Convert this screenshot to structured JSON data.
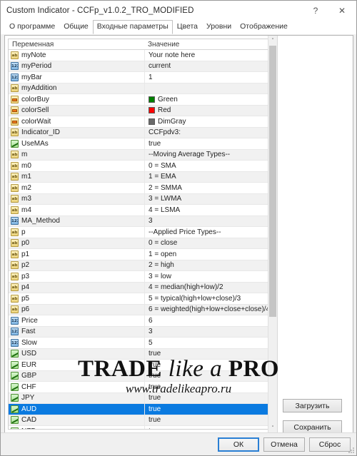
{
  "window": {
    "title": "Custom Indicator - CCFp_v1.0.2_TRO_MODIFIED",
    "help_label": "?",
    "close_label": "✕"
  },
  "tabs": [
    {
      "label": "О программе",
      "active": false
    },
    {
      "label": "Общие",
      "active": false
    },
    {
      "label": "Входные параметры",
      "active": true
    },
    {
      "label": "Цвета",
      "active": false
    },
    {
      "label": "Уровни",
      "active": false
    },
    {
      "label": "Отображение",
      "active": false
    }
  ],
  "grid": {
    "columns": [
      "Переменная",
      "Значение"
    ],
    "rows": [
      {
        "icon": "string-icon",
        "name": "myNote",
        "value": "Your note here"
      },
      {
        "icon": "int-icon",
        "name": "myPeriod",
        "value": "current"
      },
      {
        "icon": "int-icon",
        "name": "myBar",
        "value": "1"
      },
      {
        "icon": "string-icon",
        "name": "myAddition",
        "value": ""
      },
      {
        "icon": "color-icon",
        "name": "colorBuy",
        "value": "Green",
        "swatch": "#008000"
      },
      {
        "icon": "color-icon",
        "name": "colorSell",
        "value": "Red",
        "swatch": "#ff0000"
      },
      {
        "icon": "color-icon",
        "name": "colorWait",
        "value": "DimGray",
        "swatch": "#696969"
      },
      {
        "icon": "string-icon",
        "name": "Indicator_ID",
        "value": "CCFpdv3:"
      },
      {
        "icon": "bool-icon",
        "name": "UseMAs",
        "value": "true"
      },
      {
        "icon": "string-icon",
        "name": "m",
        "value": "--Moving Average Types--"
      },
      {
        "icon": "string-icon",
        "name": "m0",
        "value": "0 = SMA"
      },
      {
        "icon": "string-icon",
        "name": "m1",
        "value": "1 = EMA"
      },
      {
        "icon": "string-icon",
        "name": "m2",
        "value": "2 = SMMA"
      },
      {
        "icon": "string-icon",
        "name": "m3",
        "value": "3 = LWMA"
      },
      {
        "icon": "string-icon",
        "name": "m4",
        "value": "4 = LSMA"
      },
      {
        "icon": "int-icon",
        "name": "MA_Method",
        "value": "3"
      },
      {
        "icon": "string-icon",
        "name": "p",
        "value": "--Applied Price Types--"
      },
      {
        "icon": "string-icon",
        "name": "p0",
        "value": "0 = close"
      },
      {
        "icon": "string-icon",
        "name": "p1",
        "value": "1 = open"
      },
      {
        "icon": "string-icon",
        "name": "p2",
        "value": "2 = high"
      },
      {
        "icon": "string-icon",
        "name": "p3",
        "value": "3 = low"
      },
      {
        "icon": "string-icon",
        "name": "p4",
        "value": "4 = median(high+low)/2"
      },
      {
        "icon": "string-icon",
        "name": "p5",
        "value": "5 = typical(high+low+close)/3"
      },
      {
        "icon": "string-icon",
        "name": "p6",
        "value": "6 = weighted(high+low+close+close)/4"
      },
      {
        "icon": "int-icon",
        "name": "Price",
        "value": "6"
      },
      {
        "icon": "int-icon",
        "name": "Fast",
        "value": "3"
      },
      {
        "icon": "int-icon",
        "name": "Slow",
        "value": "5"
      },
      {
        "icon": "bool-icon",
        "name": "USD",
        "value": "true"
      },
      {
        "icon": "bool-icon",
        "name": "EUR",
        "value": "true"
      },
      {
        "icon": "bool-icon",
        "name": "GBP",
        "value": "true"
      },
      {
        "icon": "bool-icon",
        "name": "CHF",
        "value": "true"
      },
      {
        "icon": "bool-icon",
        "name": "JPY",
        "value": "true"
      },
      {
        "icon": "bool-icon",
        "name": "AUD",
        "value": "true",
        "selected": true
      },
      {
        "icon": "bool-icon",
        "name": "CAD",
        "value": "true"
      },
      {
        "icon": "bool-icon",
        "name": "NZD",
        "value": "true"
      }
    ],
    "scroll_up_glyph": "˄",
    "scroll_down_glyph": "˅"
  },
  "side_buttons": {
    "load": "Загрузить",
    "save": "Сохранить"
  },
  "dialog_buttons": {
    "ok": "ОК",
    "cancel": "Отмена",
    "reset": "Сброс"
  },
  "watermark": {
    "word1": "TRADE",
    "word2": "like a",
    "word3": "PRO",
    "url": "www.tradelikeapro.ru"
  },
  "colors": {
    "selection": "#0a7ae0",
    "accent": "#2a7fd4"
  }
}
